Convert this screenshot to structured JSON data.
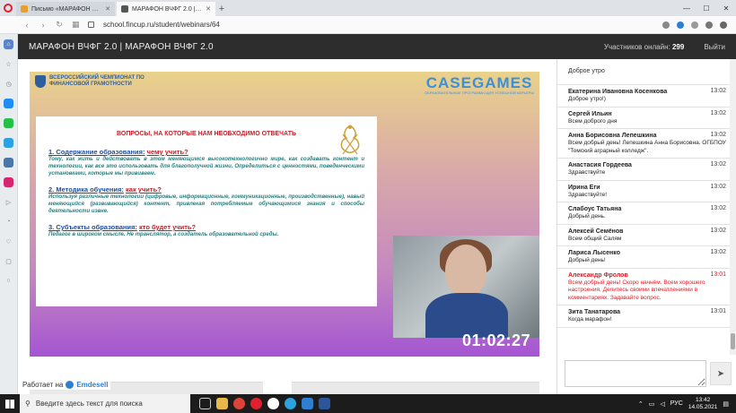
{
  "browser": {
    "tabs": [
      {
        "title": "Письмо «МАРАФОН ВЧФ",
        "active": false,
        "color": "#e8a02a"
      },
      {
        "title": "МАРАФОН ВЧФГ 2.0 | МАР",
        "active": true,
        "color": "#555555"
      }
    ],
    "url": "school.fincup.ru/student/webinars/64",
    "new_tab": "+"
  },
  "header": {
    "title": "МАРАФОН ВЧФГ 2.0 | МАРАФОН ВЧФГ 2.0",
    "online_label": "Участников онлайн:",
    "online_count": "299",
    "logout": "Выйти"
  },
  "video": {
    "champ_logo_text": "ВСЕРОССИЙСКИЙ ЧЕМПИОНАТ ПО ФИНАНСОВОЙ ГРАМОТНОСТИ",
    "casegames": "CASEGAMES",
    "casegames_sub": "ОБРАЗОВАТЕЛЬНЫЕ ПРОГРАММЫ ДЛЯ УСПЕШНОЙ КАРЬЕРЫ",
    "slide": {
      "title": "ВОПРОСЫ, НА КОТОРЫЕ НАМ НЕОБХОДИМО ОТВЕЧАТЬ",
      "s1_head": "1. Содержание образования:",
      "s1_q": "чему учить?",
      "s1_body": "Тому, как жить и действовать в этом меняющимся высокотехнологично мире, как создавать контент и технологии, как все это использовать для благополучной жизни. Определиться с ценностями, поведенческими установками, которые мы прививаем.",
      "s2_head": "2. Методика обучения:",
      "s2_q": "как учить?",
      "s2_body": "Используя различные технологии (цифровые, информационные, коммуникационные, производственные), навый меняющийся (развивающийся) контент, привлекая потребляемые обучающимися знания и способы деятельности извне.",
      "s3_head": "3. Субъекты образования:",
      "s3_q": "кто будет учить?",
      "s3_body": "Педагог в широком смысле. Не транслятор, а создатель образовательной среды."
    },
    "timer": "01:02:27"
  },
  "chat": {
    "first": "Доброе утро",
    "messages": [
      {
        "name": "Екатерина Ивановна Косенкова",
        "time": "13:02",
        "text": "Доброе утро!)",
        "highlight": false
      },
      {
        "name": "Сергей Ильин",
        "time": "13:02",
        "text": "Всем доброго дня",
        "highlight": false
      },
      {
        "name": "Анна Борисовна Лепешкина",
        "time": "13:02",
        "text": "Всем добрый день! Лепешкина Анна Борисовна. ОГБПОУ \"Томский аграрный колледж\".",
        "highlight": false
      },
      {
        "name": "Анастасия Гордеева",
        "time": "13:02",
        "text": "Здравствуйте",
        "highlight": false
      },
      {
        "name": "Ирина Еги",
        "time": "13:02",
        "text": "Здравствуйте!",
        "highlight": false
      },
      {
        "name": "Слабоус Татьяна",
        "time": "13:02",
        "text": "Добрый день.",
        "highlight": false
      },
      {
        "name": "Алексей Семёнов",
        "time": "13:02",
        "text": "Всем общий Салям",
        "highlight": false
      },
      {
        "name": "Лариса Лысенко",
        "time": "13:02",
        "text": "Добрый день!",
        "highlight": false
      },
      {
        "name": "Александр Фролов",
        "time": "13:01",
        "text": "Всем добрый день! Скоро начнём. Всем хорошего настроения. Делитесь своими впечатлениями в комментариях. Задавайте вопрос.",
        "highlight": true
      },
      {
        "name": "Зита Танатарова",
        "time": "13:01",
        "text": "Когда марафон!",
        "highlight": false
      }
    ],
    "send": "➤"
  },
  "footer": {
    "works_on": "Работает на",
    "brand": "Emdesell"
  },
  "taskbar": {
    "search_placeholder": "Введите здесь текст для поиска",
    "lang": "РУС",
    "time": "13:42",
    "date": "14.05.2021"
  }
}
